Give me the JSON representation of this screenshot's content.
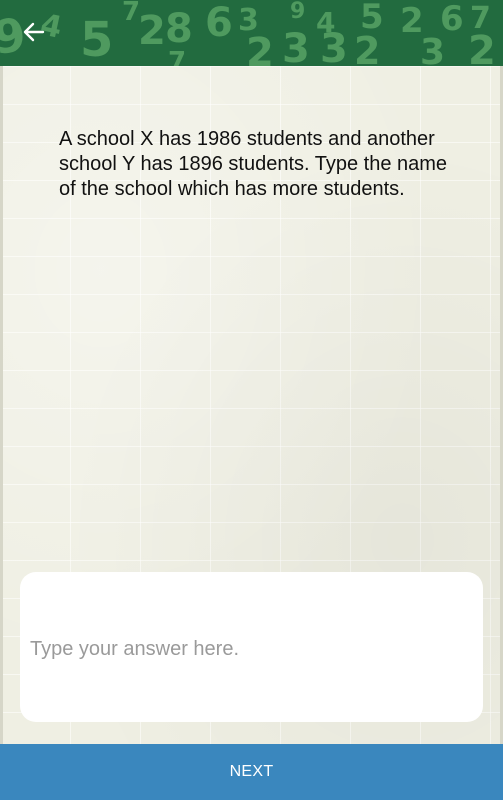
{
  "header": {
    "back_icon": "arrow-left-icon",
    "background_color": "#226b3f",
    "pattern_color": "#4f9a5f"
  },
  "question": {
    "text": "A school X has 1986 students and another school Y has 1896 students. Type the name of the school which has more students."
  },
  "answer": {
    "value": "",
    "placeholder": "Type your answer here."
  },
  "footer": {
    "next_label": "NEXT",
    "background_color": "#3a87be"
  }
}
